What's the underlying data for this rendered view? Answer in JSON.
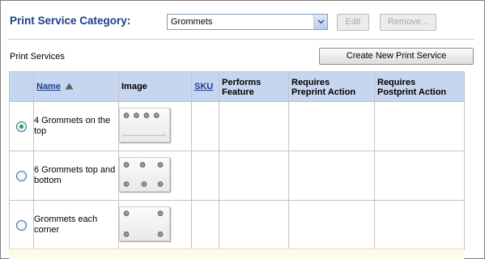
{
  "header": {
    "category_label": "Print Service Category:",
    "category_select": {
      "value": "Grommets"
    },
    "edit_label": "Edit",
    "remove_label": "Remove..."
  },
  "print_services": {
    "section_label": "Print Services",
    "create_button_label": "Create New Print Service",
    "columns": {
      "name": "Name",
      "image": "Image",
      "sku": "SKU",
      "performs_feature": [
        "Performs",
        "Feature"
      ],
      "requires_preprint": [
        "Requires",
        "Preprint Action"
      ],
      "requires_postprint": [
        "Requires",
        "Postprint Action"
      ]
    },
    "rows": [
      {
        "name": "4 Grommets on the top",
        "selected": true,
        "image_icon": "grommets-top-thumbnail"
      },
      {
        "name": "6 Grommets top and bottom",
        "selected": false,
        "image_icon": "grommets-top-bottom-thumbnail"
      },
      {
        "name": "Grommets each corner",
        "selected": false,
        "image_icon": "grommets-corners-thumbnail"
      }
    ]
  },
  "colors": {
    "header_text": "#1f3d8c",
    "table_header_bg": "#c7d6f0",
    "radio_selected": "#23a32f"
  }
}
